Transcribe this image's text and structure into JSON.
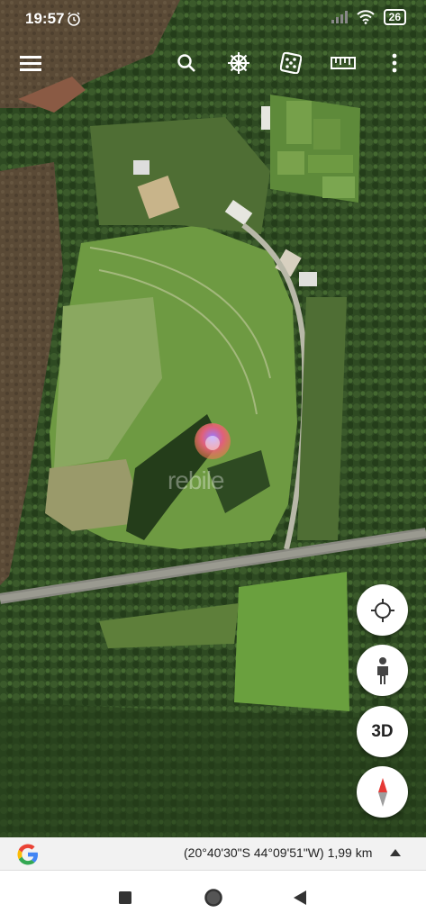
{
  "status": {
    "time": "19:57",
    "battery": "26"
  },
  "toolbar": {
    "icons": [
      "menu-icon",
      "search-icon",
      "voyager-wheel-icon",
      "dice-icon",
      "ruler-icon",
      "more-vert-icon"
    ]
  },
  "map": {
    "watermark_text": "rebile"
  },
  "controls": {
    "three_d_label": "3D"
  },
  "footer": {
    "coordinates": "(20°40'30\"S 44°09'51\"W) 1,99 km"
  },
  "colors": {
    "forest": "#2f4a24",
    "field": "#6a9a3e",
    "road": "#8a8a80",
    "bar": "#f2f2f2"
  }
}
